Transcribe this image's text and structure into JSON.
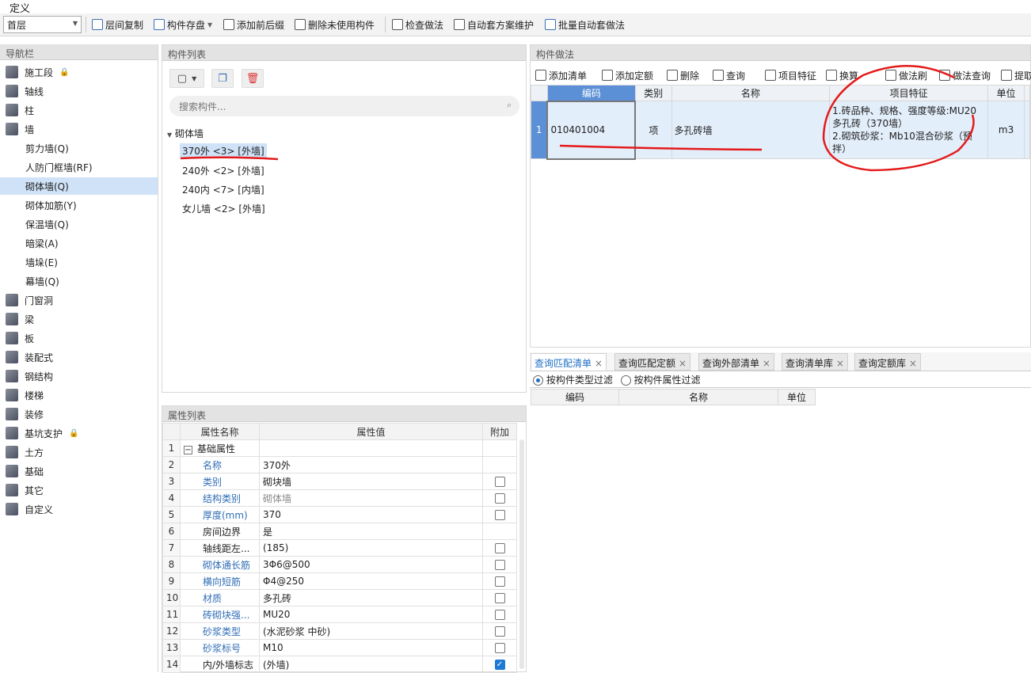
{
  "menu": {
    "title": "定义"
  },
  "toolbar": {
    "floor": "首层",
    "items": [
      "层间复制",
      "构件存盘",
      "添加前后缀",
      "删除未使用构件",
      "检查做法",
      "自动套方案维护",
      "批量自动套做法"
    ]
  },
  "nav": {
    "header": "导航栏",
    "items": [
      {
        "label": "施工段",
        "lock": true
      },
      {
        "label": "轴线"
      },
      {
        "label": "柱"
      },
      {
        "label": "墙"
      },
      {
        "label": "剪力墙(Q)",
        "sub": true
      },
      {
        "label": "人防门框墙(RF)",
        "sub": true
      },
      {
        "label": "砌体墙(Q)",
        "sub": true,
        "selected": true
      },
      {
        "label": "砌体加筋(Y)",
        "sub": true
      },
      {
        "label": "保温墙(Q)",
        "sub": true
      },
      {
        "label": "暗梁(A)",
        "sub": true
      },
      {
        "label": "墙垛(E)",
        "sub": true
      },
      {
        "label": "幕墙(Q)",
        "sub": true
      },
      {
        "label": "门窗洞"
      },
      {
        "label": "梁"
      },
      {
        "label": "板"
      },
      {
        "label": "装配式"
      },
      {
        "label": "钢结构"
      },
      {
        "label": "楼梯"
      },
      {
        "label": "装修"
      },
      {
        "label": "基坑支护",
        "lock": true
      },
      {
        "label": "土方"
      },
      {
        "label": "基础"
      },
      {
        "label": "其它"
      },
      {
        "label": "自定义"
      }
    ]
  },
  "components": {
    "header": "构件列表",
    "search_placeholder": "搜索构件...",
    "group": "砌体墙",
    "items": [
      "370外 <3> [外墙]",
      "240外 <2> [外墙]",
      "240内 <7> [内墙]",
      "女儿墙 <2> [外墙]"
    ]
  },
  "props": {
    "header": "属性列表",
    "col_name": "属性名称",
    "col_value": "属性值",
    "col_extra": "附加",
    "rows": [
      {
        "n": "1",
        "name": "基础属性",
        "value": "",
        "group": true
      },
      {
        "n": "2",
        "name": "名称",
        "value": "370外",
        "blue": true
      },
      {
        "n": "3",
        "name": "类别",
        "value": "砌块墙",
        "blue": true,
        "chk": "off"
      },
      {
        "n": "4",
        "name": "结构类别",
        "value": "砌体墙",
        "blue": true,
        "grey": true,
        "chk": "off"
      },
      {
        "n": "5",
        "name": "厚度(mm)",
        "value": "370",
        "blue": true,
        "chk": "off"
      },
      {
        "n": "6",
        "name": "房间边界",
        "value": "是"
      },
      {
        "n": "7",
        "name": "轴线距左...",
        "value": "(185)",
        "chk": "off"
      },
      {
        "n": "8",
        "name": "砌体通长筋",
        "value": "3Φ6@500",
        "blue": true,
        "chk": "off"
      },
      {
        "n": "9",
        "name": "横向短筋",
        "value": "Φ4@250",
        "blue": true,
        "chk": "off"
      },
      {
        "n": "10",
        "name": "材质",
        "value": "多孔砖",
        "blue": true,
        "chk": "off"
      },
      {
        "n": "11",
        "name": "砖砌块强...",
        "value": "MU20",
        "blue": true,
        "chk": "off"
      },
      {
        "n": "12",
        "name": "砂浆类型",
        "value": "(水泥砂浆 中砂)",
        "blue": true,
        "chk": "off"
      },
      {
        "n": "13",
        "name": "砂浆标号",
        "value": "M10",
        "blue": true,
        "chk": "off"
      },
      {
        "n": "14",
        "name": "内/外墙标志",
        "value": "(外墙)",
        "chk": "on"
      }
    ]
  },
  "method": {
    "header": "构件做法",
    "tools": [
      "添加清单",
      "添加定额",
      "删除",
      "查询",
      "项目特征",
      "换算",
      "做法刷",
      "做法查询",
      "提取"
    ],
    "cols": [
      "编码",
      "类别",
      "名称",
      "项目特征",
      "单位"
    ],
    "row": {
      "n": "1",
      "code": "010401004",
      "type": "项",
      "name": "多孔砖墙",
      "feature": "1.砖品种、规格、强度等级:MU20多孔砖（370墙）\n2.砌筑砂浆：Mb10混合砂浆（预拌）",
      "unit": "m3"
    }
  },
  "query": {
    "tabs": [
      "查询匹配清单",
      "查询匹配定额",
      "查询外部清单",
      "查询清单库",
      "查询定额库"
    ],
    "filter1": "按构件类型过滤",
    "filter2": "按构件属性过滤",
    "cols": [
      "编码",
      "名称",
      "单位"
    ]
  },
  "colors": {
    "selected": "#cfe2f7",
    "annotation": "#e41a1a",
    "link": "#2f6db5"
  }
}
